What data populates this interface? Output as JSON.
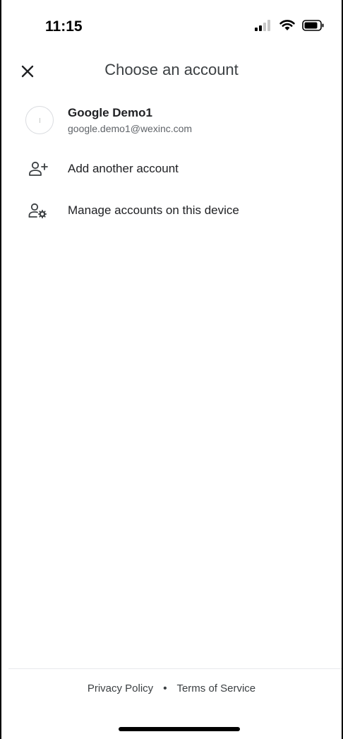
{
  "status_bar": {
    "time": "11:15",
    "icons": [
      "cellular-signal-icon",
      "wifi-icon",
      "battery-icon"
    ]
  },
  "header": {
    "title": "Choose an account",
    "close_icon": "close-icon"
  },
  "account": {
    "name": "Google Demo1",
    "email": "google.demo1@wexinc.com"
  },
  "actions": {
    "add_account": {
      "label": "Add another account",
      "icon": "person-add-icon"
    },
    "manage_accounts": {
      "label": "Manage accounts on this device",
      "icon": "manage-accounts-icon"
    }
  },
  "footer": {
    "privacy": "Privacy Policy",
    "separator": "•",
    "terms": "Terms of Service"
  },
  "colors": {
    "text_primary": "#202124",
    "text_secondary": "#5f6368",
    "divider": "#e8eaed"
  }
}
